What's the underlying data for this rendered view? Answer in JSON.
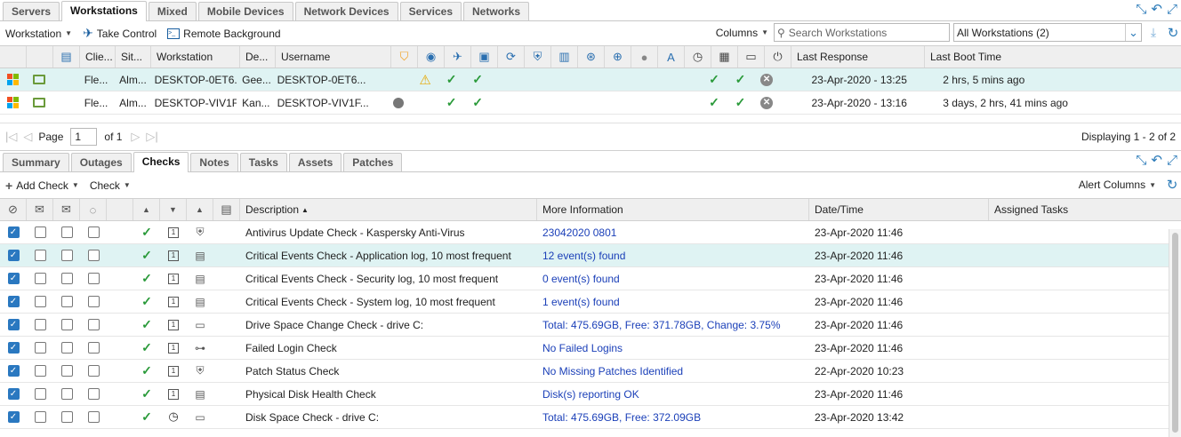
{
  "top_tabs": [
    "Servers",
    "Workstations",
    "Mixed",
    "Mobile Devices",
    "Network Devices",
    "Services",
    "Networks"
  ],
  "top_active": 1,
  "toolbar": {
    "workstation_label": "Workstation",
    "take_control_label": "Take Control",
    "remote_background_label": "Remote Background",
    "columns_label": "Columns",
    "search_placeholder": "Search Workstations",
    "filter_value": "All Workstations (2)"
  },
  "device_table": {
    "headers": [
      "Clie...",
      "Sit...",
      "Workstation",
      "De...",
      "Username",
      "Last Response",
      "Last Boot Time"
    ],
    "rows": [
      {
        "client": "Fle...",
        "site": "Alm...",
        "workstation": "DESKTOP-0ET6...",
        "desc": "Gee...",
        "username": "DESKTOP-0ET6...",
        "last_response": "23-Apr-2020 - 13:25",
        "last_boot": "2 hrs, 5 mins ago",
        "selected": true
      },
      {
        "client": "Fle...",
        "site": "Alm...",
        "workstation": "DESKTOP-VIV1F...",
        "desc": "Kan...",
        "username": "DESKTOP-VIV1F...",
        "last_response": "23-Apr-2020 - 13:16",
        "last_boot": "3 days, 2 hrs, 41 mins ago",
        "selected": false
      }
    ]
  },
  "pager": {
    "page_label": "Page",
    "page_value": "1",
    "of_label": "of 1",
    "displaying": "Displaying 1 - 2 of 2"
  },
  "bottom_tabs": [
    "Summary",
    "Outages",
    "Checks",
    "Notes",
    "Tasks",
    "Assets",
    "Patches"
  ],
  "bottom_active": 2,
  "check_toolbar": {
    "add_check_label": "Add Check",
    "check_label": "Check",
    "alert_columns_label": "Alert Columns"
  },
  "checks_table": {
    "headers": [
      "Description",
      "More Information",
      "Date/Time",
      "Assigned Tasks"
    ],
    "rows": [
      {
        "description": "Antivirus Update Check - Kaspersky Anti-Virus",
        "info": "23042020 0801",
        "datetime": "23-Apr-2020 11:46",
        "selected": false
      },
      {
        "description": "Critical Events Check - Application log, 10 most frequent",
        "info": "12 event(s) found",
        "datetime": "23-Apr-2020 11:46",
        "selected": true
      },
      {
        "description": "Critical Events Check - Security log, 10 most frequent",
        "info": "0 event(s) found",
        "datetime": "23-Apr-2020 11:46",
        "selected": false
      },
      {
        "description": "Critical Events Check - System log, 10 most frequent",
        "info": "1 event(s) found",
        "datetime": "23-Apr-2020 11:46",
        "selected": false
      },
      {
        "description": "Drive Space Change Check - drive C:",
        "info": "Total: 475.69GB, Free: 371.78GB, Change: 3.75%",
        "datetime": "23-Apr-2020 11:46",
        "selected": false
      },
      {
        "description": "Failed Login Check",
        "info": "No Failed Logins",
        "datetime": "23-Apr-2020 11:46",
        "selected": false
      },
      {
        "description": "Patch Status Check",
        "info": "No Missing Patches Identified",
        "datetime": "22-Apr-2020 10:23",
        "selected": false
      },
      {
        "description": "Physical Disk Health Check",
        "info": "Disk(s) reporting OK",
        "datetime": "23-Apr-2020 11:46",
        "selected": false
      },
      {
        "description": "Disk Space Check - drive C:",
        "info": "Total: 475.69GB, Free: 372.09GB",
        "datetime": "23-Apr-2020 13:42",
        "selected": false
      }
    ]
  }
}
